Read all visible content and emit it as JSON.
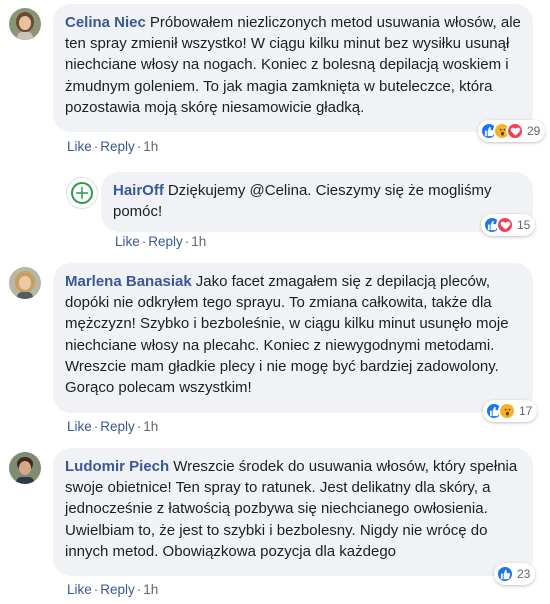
{
  "comments": [
    {
      "author": "Celina Niec",
      "text": "Próbowałem niezliczonych metod usuwania włosów, ale ten spray zmienił wszystko! W ciągu kilku minut bez wysiłku usunął niechciane włosy na nogach. Koniec z bolesną depilacją woskiem i żmudnym goleniem. To jak magia zamknięta w buteleczce, która pozostawia moją skórę niesamowicie gładką.",
      "reactions": [
        "like",
        "wow",
        "love"
      ],
      "reaction_count": "29",
      "actions": {
        "like": "Like",
        "reply": "Reply",
        "time": "1h"
      }
    },
    {
      "author": "HairOff",
      "text": "Dziękujemy @Celina. Cieszymy się że mogliśmy pomóc!",
      "reactions": [
        "like",
        "love"
      ],
      "reaction_count": "15",
      "actions": {
        "like": "Like",
        "reply": "Reply",
        "time": "1h"
      }
    },
    {
      "author": "Marlena Banasiak",
      "text": "Jako facet zmagałem się z depilacją pleców, dopóki nie odkryłem tego sprayu. To zmiana całkowita, także dla mężczyzn! Szybko i bezboleśnie, w ciągu kilku minut usunęło moje niechciane włosy na plecahc. Koniec z niewygodnymi metodami. Wreszcie mam gładkie plecy i nie mogę być bardziej zadowolony. Gorąco polecam wszystkim!",
      "reactions": [
        "like",
        "wow"
      ],
      "reaction_count": "17",
      "actions": {
        "like": "Like",
        "reply": "Reply",
        "time": "1h"
      }
    },
    {
      "author": "Ludomir Piech",
      "text": "Wreszcie środek do usuwania włosów, który spełnia swoje obietnice! Ten spray to ratunek. Jest delikatny dla skóry, a jednocześnie z łatwością pozbywa się niechcianego owłosienia. Uwielbiam to, że jest to szybki i bezbolesny. Nigdy nie wrócę do innych metod. Obowiązkowa pozycja dla każdego",
      "reactions": [
        "like"
      ],
      "reaction_count": "23",
      "actions": {
        "like": "Like",
        "reply": "Reply",
        "time": "1h"
      }
    }
  ],
  "colors": {
    "link": "#385898",
    "bubble": "#f0f2f5",
    "like": "#1877f2",
    "love": "#f33e58",
    "wow": "#f7b125"
  },
  "avatars": [
    "woman-photo-avatar",
    "hairoff-logo-avatar",
    "woman-photo-avatar",
    "man-photo-avatar"
  ]
}
